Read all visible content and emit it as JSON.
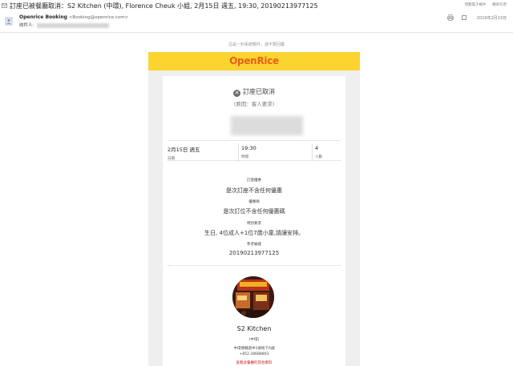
{
  "email": {
    "subject": "訂座已被餐廳取消：S2 Kitchen (中環), Florence Cheuk 小姐, 2月15日 週五, 19:30, 20190213977125",
    "top_links": [
      "預覽電子郵件",
      "轉寄作用"
    ],
    "sender_name": "Openrice Booking",
    "sender_email": "<Booking@openrice.com>",
    "recipient_label": "收件人:",
    "header_date": "2019年2月13日"
  },
  "notice": "這是一封系統郵件，請不要回覆",
  "logo": {
    "text_open": "Open",
    "text_rice": "Rice"
  },
  "booking": {
    "status": "訂座已取消",
    "reason": "(原因：客人要求)",
    "date_value": "2月15日 週五",
    "date_label": "日期",
    "time_value": "19:30",
    "time_label": "時間",
    "people_value": "4",
    "people_label": "人數",
    "details": [
      {
        "label": "訂座優惠",
        "value": "是次訂座不含任何優惠"
      },
      {
        "label": "優惠碼",
        "value": "是次訂位不含任何優惠碼"
      },
      {
        "label": "特別要求",
        "value": "生日, 4位成人+1位7歲小童,請讓安排。"
      },
      {
        "label": "參考編號",
        "value": "20190213977125"
      }
    ]
  },
  "restaurant": {
    "name": "S2 Kitchen",
    "district": "(中環)",
    "address": "中環德輔道中1號地下A舖",
    "phone": "+852 28688803",
    "note": "查看此餐廳的其他資料"
  }
}
